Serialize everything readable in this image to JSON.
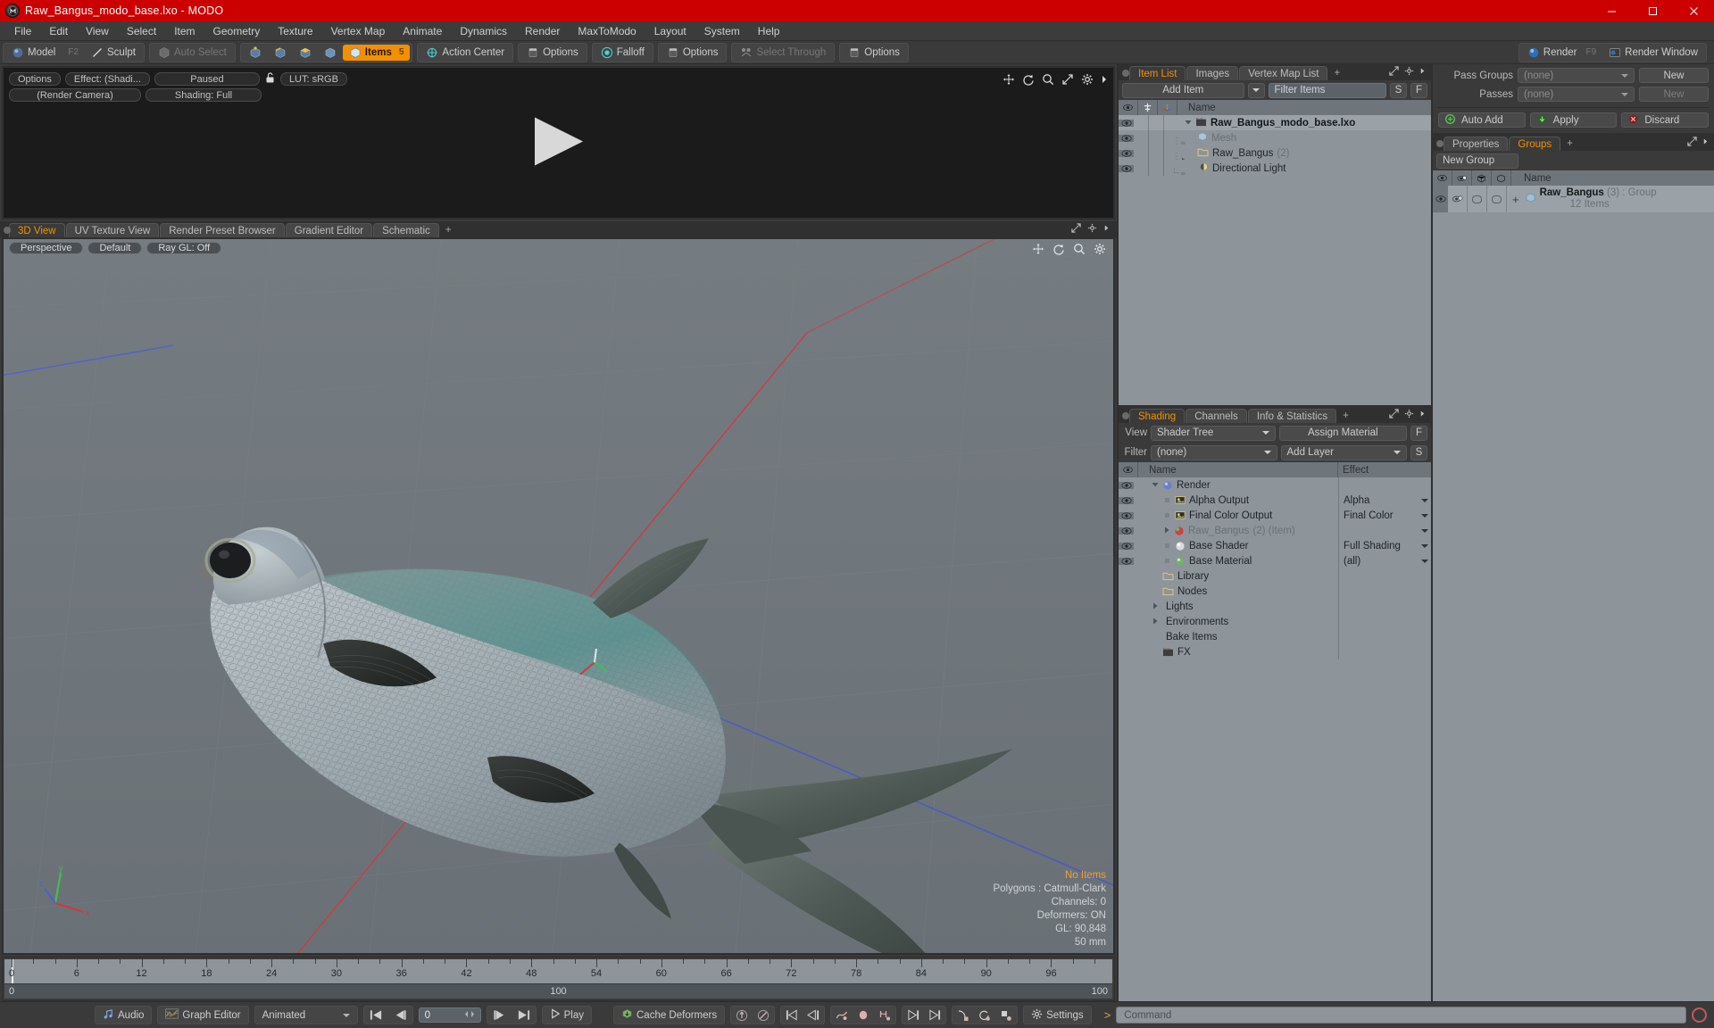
{
  "window": {
    "title": "Raw_Bangus_modo_base.lxo - MODO",
    "app_icon": "modo-logo-icon",
    "minimize": "–",
    "maximize": "☐",
    "close": "✕",
    "titlebar_color": "#cc0000"
  },
  "menubar": {
    "items": [
      "File",
      "Edit",
      "View",
      "Select",
      "Item",
      "Geometry",
      "Texture",
      "Vertex Map",
      "Animate",
      "Dynamics",
      "Render",
      "MaxToModo",
      "Layout",
      "System",
      "Help"
    ]
  },
  "modebar": {
    "mode_group": [
      {
        "label": "Model",
        "icon": "sphere-icon",
        "shortcut": "F2"
      },
      {
        "label": "Sculpt",
        "icon": "pen-icon",
        "shortcut": ""
      }
    ],
    "auto_select": {
      "label": "Auto Select",
      "icon": "cube-gray-icon",
      "dim": true
    },
    "select_modes": [
      "vertex-select-icon",
      "edge-select-icon",
      "polygon-select-icon",
      "material-select-icon"
    ],
    "items_button": {
      "label": "Items",
      "badge": "5",
      "icon": "cube-orange-icon",
      "active": true
    },
    "action_center": {
      "label": "Action Center",
      "icon": "action-center-icon"
    },
    "action_center_options": {
      "label": "Options",
      "icon": "panel-icon"
    },
    "falloff": {
      "label": "Falloff",
      "icon": "falloff-icon"
    },
    "falloff_options": {
      "label": "Options",
      "icon": "panel-icon"
    },
    "select_through": {
      "label": "Select Through",
      "icon": "select-through-icon",
      "dim": true
    },
    "select_through_options": {
      "label": "Options",
      "icon": "panel-icon"
    },
    "render": {
      "label": "Render",
      "shortcut": "F9",
      "icon": "render-icon"
    },
    "render_window": {
      "label": "Render Window",
      "icon": "render-window-icon"
    }
  },
  "render_preview": {
    "options": "Options",
    "effect": "Effect: (Shadi...",
    "paused": "Paused",
    "lock_icon": "unlock-icon",
    "lut": "LUT: sRGB",
    "camera": "(Render Camera)",
    "shading": "Shading: Full",
    "icons": [
      "move-icon",
      "rotate-icon",
      "zoom-icon",
      "fit-icon",
      "gear-icon",
      "chevron-right-icon"
    ],
    "play_overlay": "play-triangle-icon"
  },
  "viewport": {
    "tabs": [
      {
        "label": "3D View",
        "active": true
      },
      {
        "label": "UV Texture View",
        "active": false
      },
      {
        "label": "Render Preset Browser",
        "active": false
      },
      {
        "label": "Gradient Editor",
        "active": false
      },
      {
        "label": "Schematic",
        "active": false
      }
    ],
    "add_tab": "+",
    "tab_icons": [
      "maximize-icon",
      "gear-icon",
      "chevron-right-icon"
    ],
    "header_pills": [
      "Perspective",
      "Default",
      "Ray GL: Off"
    ],
    "overlay_icons": [
      "move-icon",
      "rotate-icon",
      "zoom-icon",
      "gear-icon"
    ],
    "stats": [
      {
        "text": "No Items",
        "highlight": true
      },
      {
        "text": "Polygons : Catmull-Clark",
        "highlight": false
      },
      {
        "text": "Channels: 0",
        "highlight": false
      },
      {
        "text": "Deformers: ON",
        "highlight": false
      },
      {
        "text": "GL: 90,848",
        "highlight": false
      },
      {
        "text": "50 mm",
        "highlight": false
      }
    ],
    "axis_gizmo": "axis-gizmo-icon",
    "background_color": "#6e757a"
  },
  "item_list": {
    "tabs": [
      {
        "label": "Item List",
        "active": true
      },
      {
        "label": "Images",
        "active": false
      },
      {
        "label": "Vertex Map List",
        "active": false
      }
    ],
    "add_tab": "+",
    "tab_icons": [
      "maximize-icon",
      "gear-icon",
      "chevron-right-icon"
    ],
    "add_item": "Add Item",
    "filter_placeholder": "Filter Items",
    "s_button": "S",
    "f_button": "F",
    "columns": [
      "eye-icon",
      "lock-icon",
      "axis-icon",
      "Name"
    ],
    "rows": [
      {
        "name": "Raw_Bangus_modo_base.lxo",
        "icon": "scene-icon",
        "depth": 0,
        "expanded": true,
        "bold": true,
        "suffix": "",
        "muted": false
      },
      {
        "name": "Mesh",
        "icon": "mesh-cube-icon",
        "depth": 1,
        "expanded": null,
        "bold": false,
        "suffix": "",
        "muted": true
      },
      {
        "name": "Raw_Bangus",
        "icon": "folder-icon",
        "depth": 1,
        "expanded": false,
        "bold": false,
        "suffix": "(2)",
        "muted": false
      },
      {
        "name": "Directional Light",
        "icon": "light-icon",
        "depth": 1,
        "expanded": null,
        "bold": false,
        "suffix": "",
        "muted": false
      }
    ]
  },
  "shading": {
    "tabs": [
      {
        "label": "Shading",
        "active": true
      },
      {
        "label": "Channels",
        "active": false
      },
      {
        "label": "Info & Statistics",
        "active": false
      }
    ],
    "add_tab": "+",
    "tab_icons": [
      "maximize-icon",
      "gear-icon",
      "chevron-right-icon"
    ],
    "view_label": "View",
    "view_value": "Shader Tree",
    "assign_material": "Assign Material",
    "f_button": "F",
    "filter_label": "Filter",
    "filter_value": "(none)",
    "add_layer": "Add Layer",
    "s_button": "S",
    "columns": [
      "eye-icon",
      "Name",
      "Effect"
    ],
    "rows": [
      {
        "name": "Render",
        "effect": "",
        "icon": "sphere-blue-icon",
        "depth": 1,
        "arrow": "down",
        "eye": true,
        "dropdown": false,
        "muted": false,
        "suffix": ""
      },
      {
        "name": "Alpha Output",
        "effect": "Alpha",
        "icon": "image-icon",
        "depth": 2,
        "arrow": "dot",
        "eye": true,
        "dropdown": true,
        "muted": false,
        "suffix": ""
      },
      {
        "name": "Final Color Output",
        "effect": "Final Color",
        "icon": "image-icon",
        "depth": 2,
        "arrow": "dot",
        "eye": true,
        "dropdown": true,
        "muted": false,
        "suffix": ""
      },
      {
        "name": "Raw_Bangus",
        "effect": "",
        "icon": "sphere-red-icon",
        "depth": 2,
        "arrow": "right",
        "eye": true,
        "dropdown": true,
        "muted": true,
        "suffix": "(2) (Item)"
      },
      {
        "name": "Base Shader",
        "effect": "Full Shading",
        "icon": "sphere-white-icon",
        "depth": 2,
        "arrow": "dot",
        "eye": true,
        "dropdown": true,
        "muted": false,
        "suffix": ""
      },
      {
        "name": "Base Material",
        "effect": "(all)",
        "icon": "sphere-green-icon",
        "depth": 2,
        "arrow": "dot",
        "eye": true,
        "dropdown": true,
        "muted": false,
        "suffix": ""
      },
      {
        "name": "Library",
        "effect": "",
        "icon": "folder-icon",
        "depth": 1,
        "arrow": "none",
        "eye": false,
        "dropdown": false,
        "muted": false,
        "suffix": ""
      },
      {
        "name": "Nodes",
        "effect": "",
        "icon": "folder-icon",
        "depth": 1,
        "arrow": "none",
        "eye": false,
        "dropdown": false,
        "muted": false,
        "suffix": ""
      },
      {
        "name": "Lights",
        "effect": "",
        "icon": "none",
        "depth": 1,
        "arrow": "right",
        "eye": false,
        "dropdown": false,
        "muted": false,
        "suffix": ""
      },
      {
        "name": "Environments",
        "effect": "",
        "icon": "none",
        "depth": 1,
        "arrow": "right",
        "eye": false,
        "dropdown": false,
        "muted": false,
        "suffix": ""
      },
      {
        "name": "Bake Items",
        "effect": "",
        "icon": "none",
        "depth": 1,
        "arrow": "none",
        "eye": false,
        "dropdown": false,
        "muted": false,
        "suffix": ""
      },
      {
        "name": "FX",
        "effect": "",
        "icon": "scene-icon",
        "depth": 1,
        "arrow": "none",
        "eye": false,
        "dropdown": false,
        "muted": false,
        "suffix": ""
      }
    ]
  },
  "passes": {
    "pass_groups_label": "Pass Groups",
    "pass_groups_value": "(none)",
    "pass_groups_new": "New",
    "passes_label": "Passes",
    "passes_value": "(none)",
    "passes_new": "New",
    "auto_add": "Auto Add",
    "apply": "Apply",
    "discard": "Discard"
  },
  "groups": {
    "tabs": [
      {
        "label": "Properties",
        "active": false
      },
      {
        "label": "Groups",
        "active": true
      }
    ],
    "add_tab": "+",
    "tab_icons": [
      "maximize-icon",
      "chevron-right-icon"
    ],
    "new_group": "New Group",
    "columns": [
      "eye-icon",
      "render-eye-icon",
      "cube-icon",
      "cube-outline-icon",
      "Name"
    ],
    "rows": [
      {
        "name": "Raw_Bangus",
        "suffix": "(3) : Group",
        "sub": "12 Items",
        "icon": "group-cube-icon",
        "expander": "+"
      }
    ]
  },
  "timeline": {
    "ticks_major": [
      0,
      6,
      12,
      18,
      24,
      30,
      36,
      42,
      48,
      54,
      60,
      66,
      72,
      78,
      84,
      90,
      96
    ],
    "range_start": "0",
    "range_end": "100",
    "range_left_label": "100",
    "range_right_label": "100",
    "playhead_frame": 0,
    "frame_min": 0,
    "frame_max": 100
  },
  "bottombar": {
    "audio": {
      "label": "Audio",
      "icon": "music-note-icon"
    },
    "graph_editor": {
      "label": "Graph Editor",
      "icon": "graph-icon"
    },
    "animated_select": "Animated",
    "transport": [
      "go-start-icon",
      "step-back-icon"
    ],
    "current_frame": "0",
    "transport2": [
      "step-forward-icon",
      "go-end-icon"
    ],
    "play": {
      "label": "Play",
      "icon": "play-icon"
    },
    "cache_deformers": {
      "label": "Cache Deformers",
      "icon": "cache-icon"
    },
    "deform_icons": [
      "key-up-icon",
      "key-down-icon",
      "key-prev-icon",
      "key-prev2-icon",
      "curve-key-icon",
      "ellipse-key-icon",
      "range-key-icon",
      "key-next-icon",
      "key-next2-icon",
      "add-key-icon",
      "cycle-key-icon",
      "offset-key-icon"
    ],
    "settings": {
      "label": "Settings",
      "icon": "gear-icon"
    },
    "command_prompt": ">",
    "command_placeholder": "Command",
    "record_icon": "record-circle-icon"
  },
  "colors": {
    "accent": "#f39000",
    "titlebar": "#cc0000",
    "panel_bg": "#3a3a3a",
    "list_bg": "#8d949a",
    "viewport_bg": "#6e757a"
  }
}
